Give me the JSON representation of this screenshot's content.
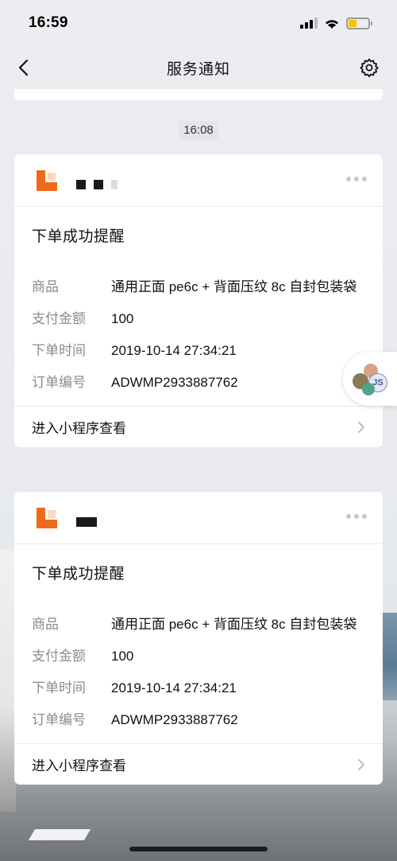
{
  "status_bar": {
    "time": "16:59"
  },
  "nav": {
    "title": "服务通知"
  },
  "timestamp": "16:08",
  "cards": [
    {
      "title": "下单成功提醒",
      "fields": [
        {
          "label": "商品",
          "value": "通用正面 pe6c + 背面压纹 8c 自封包装袋"
        },
        {
          "label": "支付金额",
          "value": "100"
        },
        {
          "label": "下单时间",
          "value": "2019-10-14 27:34:21"
        },
        {
          "label": "订单编号",
          "value": "ADWMP2933887762"
        }
      ],
      "footer_label": "进入小程序查看"
    },
    {
      "title": "下单成功提醒",
      "fields": [
        {
          "label": "商品",
          "value": "通用正面 pe6c + 背面压纹 8c 自封包装袋"
        },
        {
          "label": "支付金额",
          "value": "100"
        },
        {
          "label": "下单时间",
          "value": "2019-10-14 27:34:21"
        },
        {
          "label": "订单编号",
          "value": "ADWMP2933887762"
        }
      ],
      "footer_label": "进入小程序查看"
    }
  ],
  "floating": {
    "text": "JS"
  },
  "colors": {
    "brand_orange": "#f06a1e",
    "battery": "#f5c400"
  }
}
